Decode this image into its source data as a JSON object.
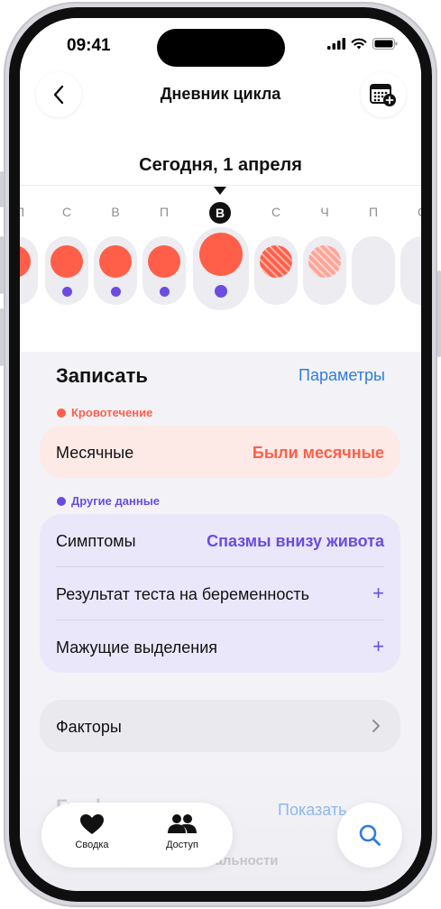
{
  "status": {
    "time": "09:41"
  },
  "header": {
    "title": "Дневник цикла",
    "date_title": "Сегодня, 1 апреля"
  },
  "week": {
    "days": [
      "П",
      "С",
      "В",
      "П",
      "В",
      "С",
      "Ч",
      "П",
      "С"
    ],
    "selected_day": "В"
  },
  "record": {
    "title": "Записать",
    "params_link": "Параметры",
    "bleeding": {
      "section_label": "Кровотечение",
      "row_label": "Месячные",
      "row_value": "Были месячные"
    },
    "other": {
      "section_label": "Другие данные",
      "rows": [
        {
          "label": "Симптомы",
          "value": "Спазмы внизу живота"
        },
        {
          "label": "Результат теста на беременность",
          "value": "+"
        },
        {
          "label": "Мажущие выделения",
          "value": "+"
        }
      ]
    },
    "factors": {
      "label": "Факторы"
    }
  },
  "below": {
    "title_partial": "Графики",
    "show_link": "Показать",
    "subtitle_partial": "...альности"
  },
  "tabbar": {
    "summary_label": "Сводка",
    "sharing_label": "Доступ"
  },
  "colors": {
    "accent_blue": "#2f7ce0",
    "period_red": "#ff5f49",
    "purple": "#6b4ce0",
    "pink_card": "#fdeae7",
    "lavender_card": "#eae7fb"
  }
}
